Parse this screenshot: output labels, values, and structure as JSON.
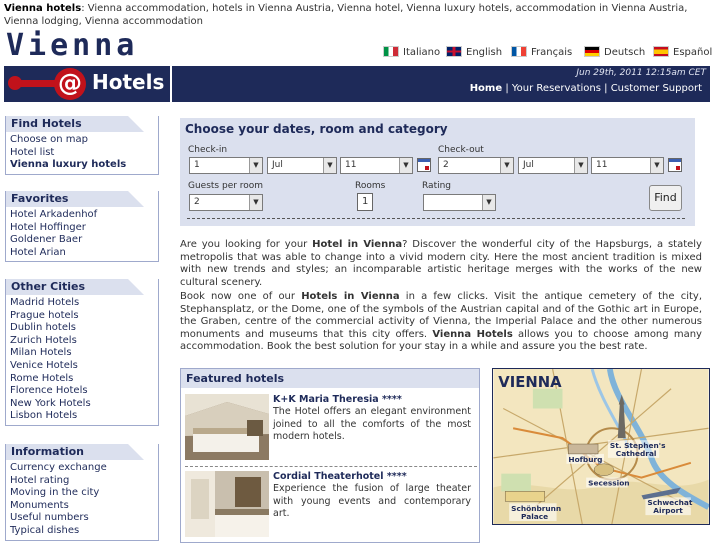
{
  "top_line": {
    "prefix": "Vienna hotels",
    "text": ": Vienna accommodation, hotels in Vienna Austria, Vienna hotel, Vienna luxury hotels, accommodation in Vienna Austria, Vienna lodging, Vienna accommodation"
  },
  "logo": {
    "word": "Vienna",
    "at": "@",
    "hotels": "Hotels"
  },
  "languages": [
    {
      "label": "Italiano",
      "colors": [
        "#009246",
        "#ffffff",
        "#ce2b37"
      ]
    },
    {
      "label": "English",
      "colors": [
        "#012169",
        "#c8102e",
        "#ffffff"
      ]
    },
    {
      "label": "Français",
      "colors": [
        "#0055a4",
        "#ffffff",
        "#ef4135"
      ]
    },
    {
      "label": "Deutsch",
      "colors": [
        "#000000",
        "#dd0000",
        "#ffce00"
      ]
    },
    {
      "label": "Español",
      "colors": [
        "#c60b1e",
        "#ffc400",
        "#c60b1e"
      ]
    }
  ],
  "nav": {
    "date": "Jun 29th, 2011 12:15am CET",
    "home": "Home",
    "reservations": "Your Reservations",
    "service": "Customer Support",
    "sep": "|"
  },
  "sidebar": {
    "find": {
      "title": "Find Hotels",
      "items": [
        "Choose on map",
        "Hotel list",
        "Vienna luxury hotels"
      ]
    },
    "favorites": {
      "title": "Favorites",
      "items": [
        "Hotel Arkadenhof",
        "Hotel Hoffinger",
        "Goldener Baer",
        "Hotel Arian"
      ]
    },
    "cities": {
      "title": "Other Cities",
      "items": [
        "Madrid Hotels",
        "Prague hotels",
        "Dublin hotels",
        "Zurich Hotels",
        "Milan Hotels",
        "Venice Hotels",
        "Rome Hotels",
        "Florence Hotels",
        "New York Hotels",
        "Lisbon Hotels"
      ]
    },
    "info": {
      "title": "Information",
      "items": [
        "Currency exchange",
        "Hotel rating",
        "Moving in the city",
        "Monuments",
        "Useful numbers",
        "Typical dishes"
      ]
    }
  },
  "search": {
    "title": "Choose your dates, room and category",
    "checkin_label": "Check-in",
    "checkout_label": "Check-out",
    "checkin_day": "1",
    "checkin_month": "Jul",
    "checkin_year": "11",
    "checkout_day": "2",
    "checkout_month": "Jul",
    "checkout_year": "11",
    "guests_label": "Guests per room",
    "guests_value": "2",
    "rooms_label": "Rooms",
    "rooms_value": "1",
    "rating_label": "Rating",
    "rating_value": "",
    "find_button": "Find"
  },
  "intro": {
    "p1_a": "Are you looking for your ",
    "p1_b": "Hotel in Vienna",
    "p1_c": "? Discover the wonderful city of the Hapsburgs, a stately metropolis that was able to change into a vivid modern city. Here the most ancient tradition is mixed with new trends and styles; an incomparable artistic heritage merges with the works of the new cultural scenery.",
    "p2_a": "Book now one of our ",
    "p2_b": "Hotels in Vienna",
    "p2_c": " in a few clicks. Visit the antique cemetery of the city, Stephansplatz, or the Dome, one of the symbols of the Austrian capital and of the Gothic art in Europe, the Graben, centre of the commercial activity of Vienna, the Imperial Palace and the other numerous monuments and museums that this city offers. ",
    "p2_d": "Vienna Hotels",
    "p2_e": " allows you to choose among many accommodation. Book the best solution for your stay in a while and assure you the best rate."
  },
  "featured": {
    "title": "Featured hotels",
    "hotels": [
      {
        "name": "K+K Maria Theresia ****",
        "desc": "The Hotel offers an elegant environment joined to all the comforts of the most modern hotels."
      },
      {
        "name": "Cordial Theaterhotel ****",
        "desc": "Experience the fusion of large theater with young events and contemporary art."
      }
    ]
  },
  "map": {
    "title": "VIENNA",
    "labels": [
      "St. Stephen's",
      "Cathedral",
      "Hofburg",
      "Secession",
      "Schönbrunn",
      "Palace",
      "Schwechat",
      "Airport"
    ]
  }
}
